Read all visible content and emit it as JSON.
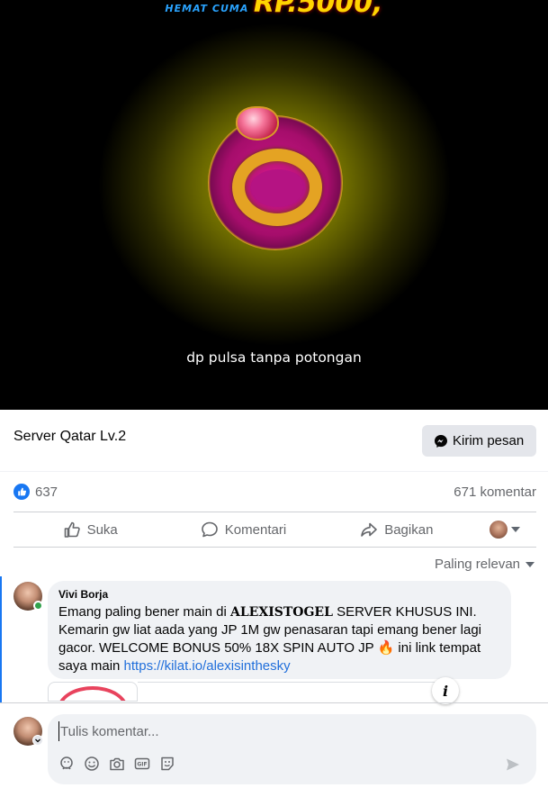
{
  "video": {
    "top_text_small": "HEMAT CUMA",
    "top_text_big": "RP.5000,",
    "caption": "dp pulsa tanpa potongan"
  },
  "post": {
    "page_name": "Server Qatar Lv.2",
    "message_button": "Kirim pesan",
    "like_count": "637",
    "comment_count": "671 komentar",
    "actions": {
      "like": "Suka",
      "comment": "Komentari",
      "share": "Bagikan"
    },
    "sort_label": "Paling relevan"
  },
  "comment": {
    "author": "Vivi Borja",
    "text_before": "Emang paling bener main di ",
    "text_bold": "ALEXISTOGEL",
    "text_after": " SERVER KHUSUS INI. Kemarin gw liat aada yang JP 1M gw penasaran tapi emang bener lagi gacor. WELCOME BONUS 50% 18X SPIN AUTO JP 🔥 ini link tempat saya main",
    "link": "https://kilat.io/alexisinthesky"
  },
  "composer": {
    "placeholder": "Tulis komentar..."
  },
  "colors": {
    "accent": "#1877f2",
    "link": "#216fdb",
    "online": "#31a24c"
  }
}
